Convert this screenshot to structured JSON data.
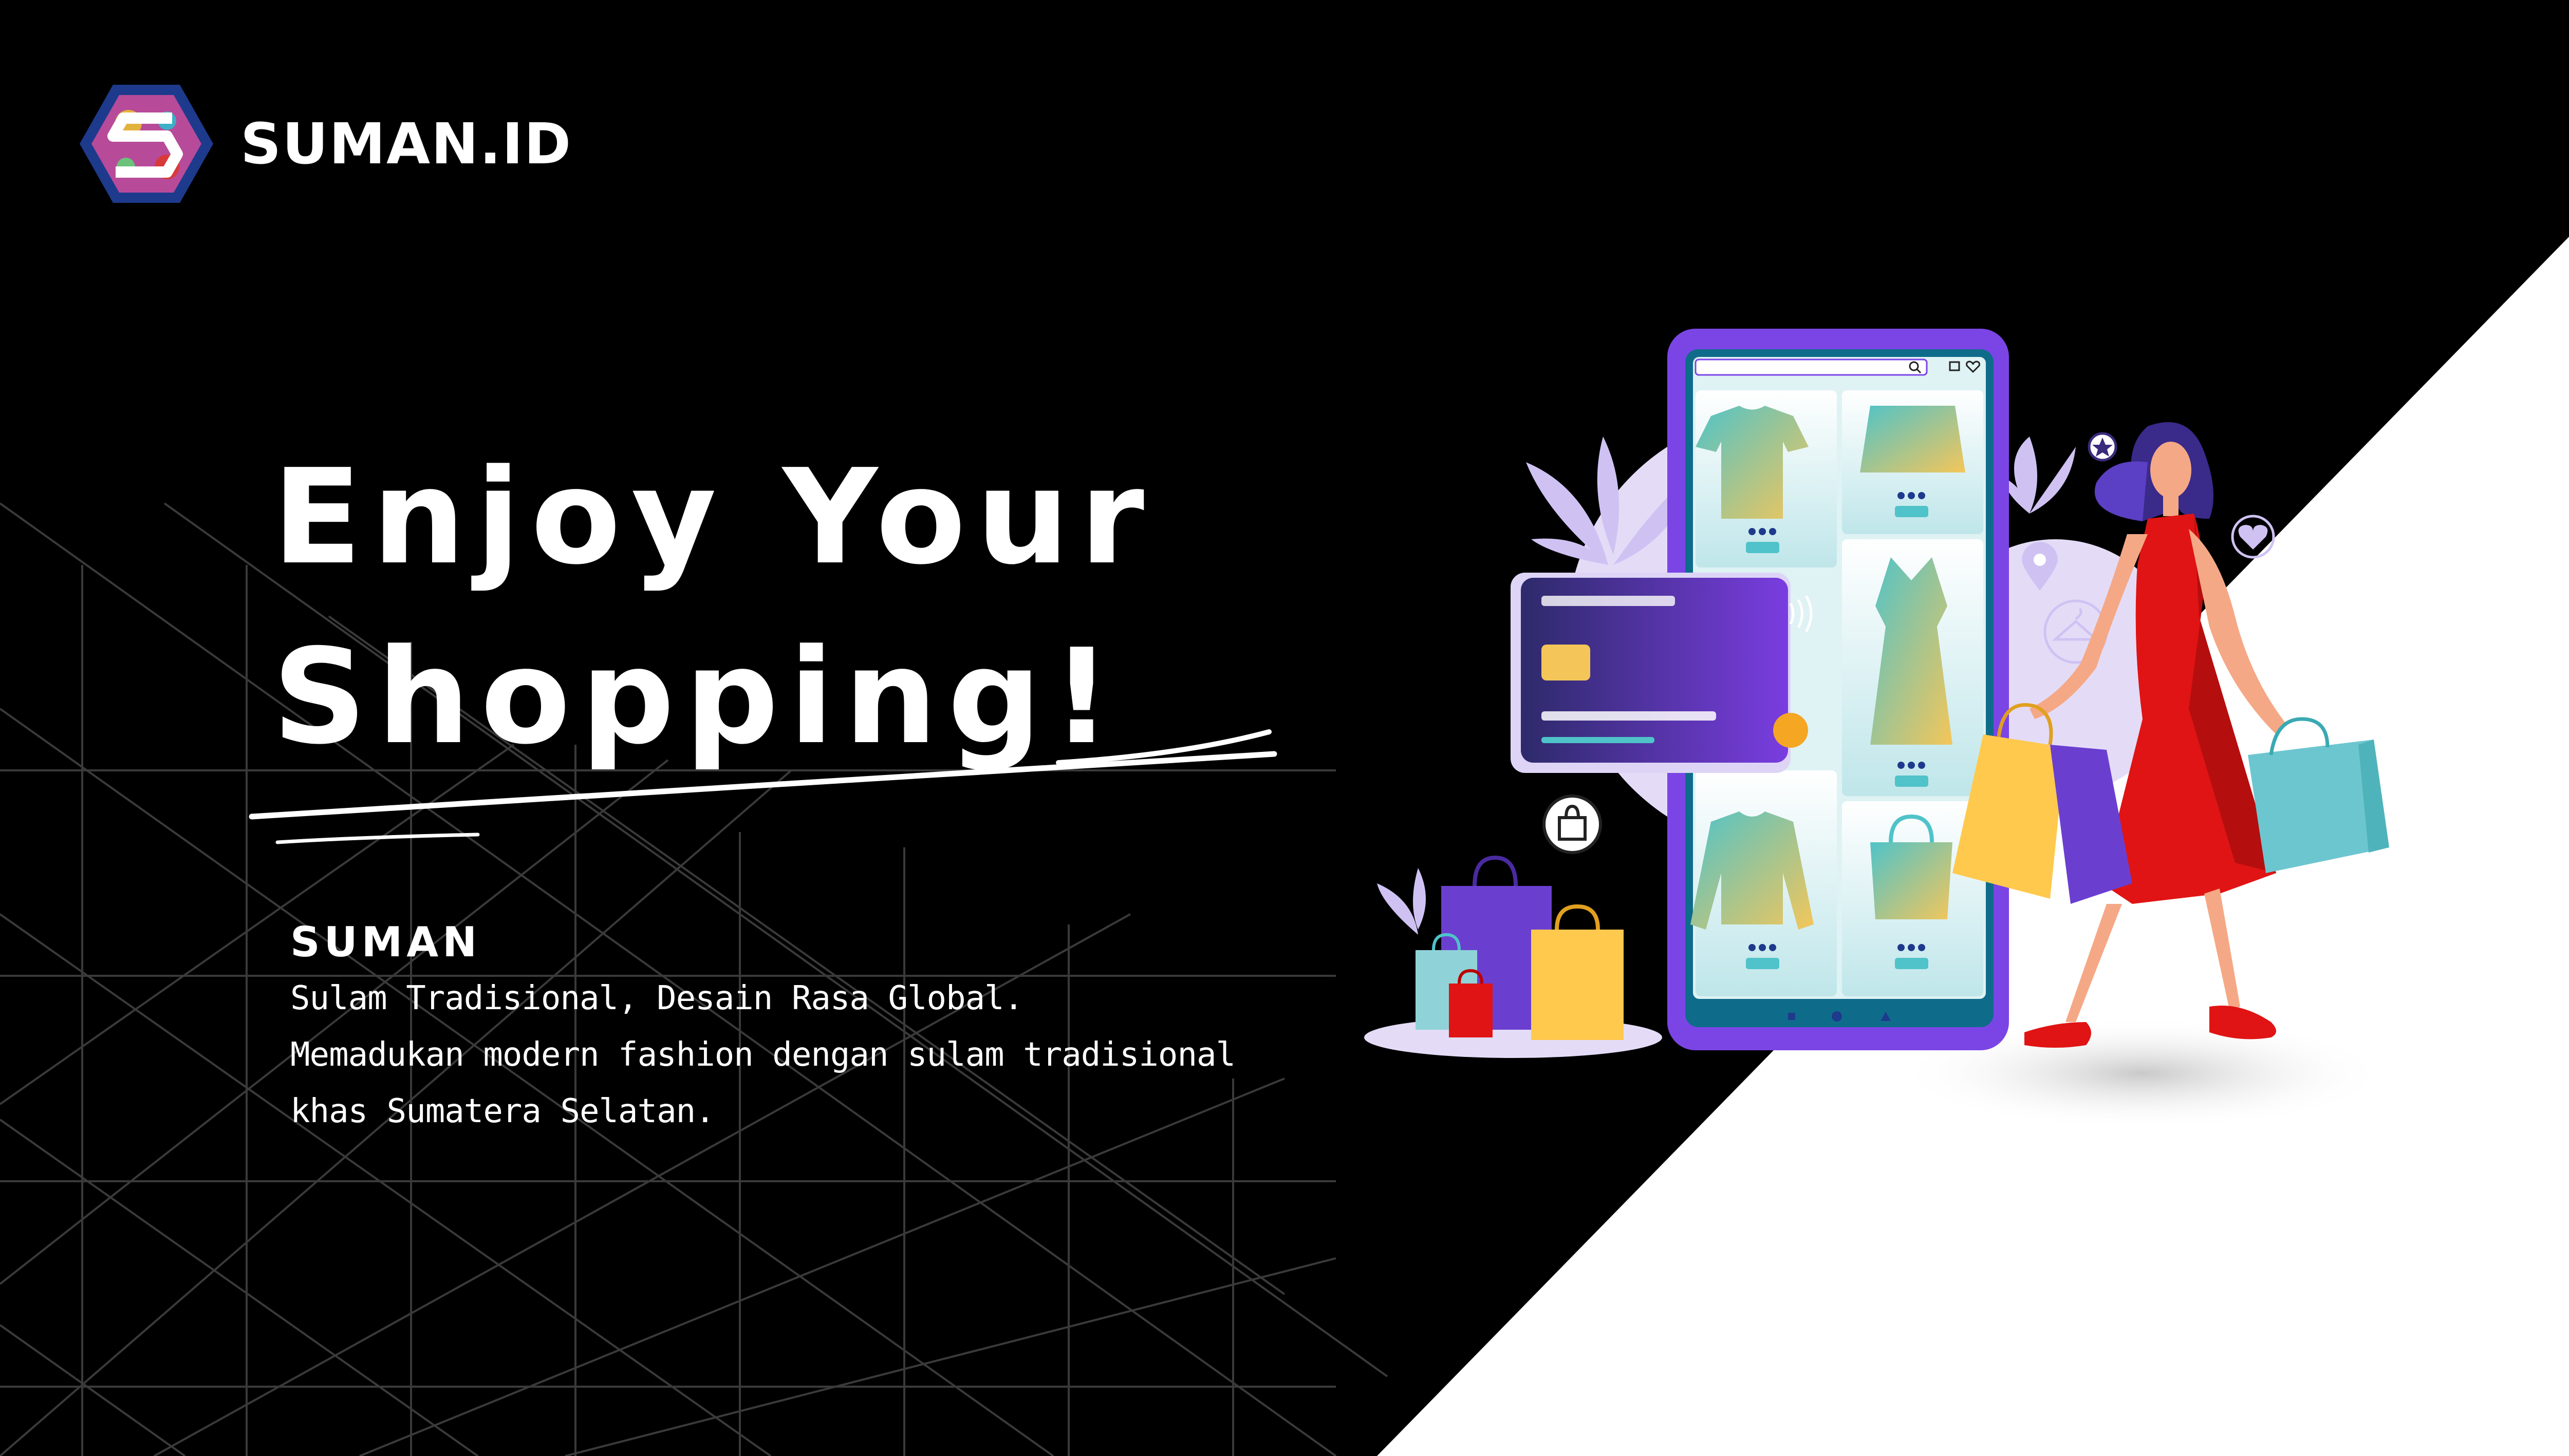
{
  "brand": {
    "name": "SUMAN.ID",
    "logo_icon": "batik-s-hexagon-logo-icon"
  },
  "hero": {
    "headline_line1": "Enjoy Your",
    "headline_line2": "Shopping!"
  },
  "description": {
    "title": "SUMAN",
    "line1": "Sulam Tradisional, Desain Rasa Global.",
    "line2": "Memadukan modern fashion dengan sulam tradisional",
    "line3": "khas Sumatera Selatan."
  },
  "illustration": {
    "phone_products": [
      "polo-shirt",
      "skirt",
      "dress",
      "sweater",
      "tote-bag"
    ],
    "icons": [
      "search-icon",
      "cart-icon",
      "heart-icon",
      "star-icon",
      "location-pin-icon",
      "hanger-icon",
      "shopping-bag-icon",
      "contactless-icon"
    ]
  },
  "colors": {
    "background": "#000000",
    "text": "#ffffff",
    "phone_frame": "#7b45e6",
    "card": "#3a2a7a",
    "accent_orange": "#f5a623",
    "dress_red": "#e01414",
    "bag_yellow": "#ffc94d",
    "bag_teal": "#6cc6cf",
    "bag_purple": "#6a3fd0"
  }
}
